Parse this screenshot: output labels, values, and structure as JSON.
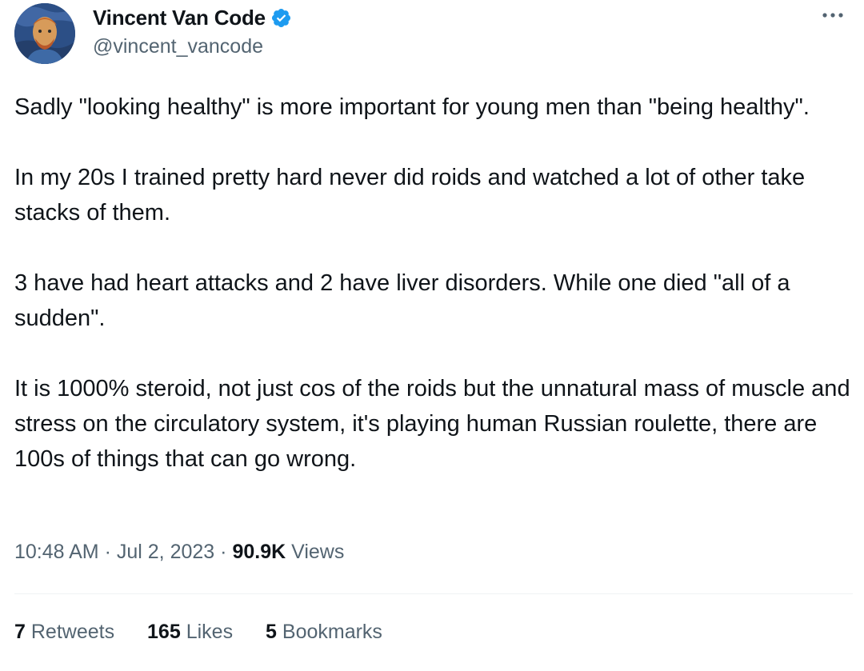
{
  "author": {
    "display_name": "Vincent Van Code",
    "handle": "@vincent_vancode",
    "verified": true,
    "verified_badge_color": "#1d9bf0"
  },
  "tweet": {
    "paragraphs": [
      "Sadly \"looking healthy\" is more important for young men than \"being healthy\".",
      "In my 20s I trained pretty hard never did roids and watched a lot of other take stacks of them.",
      "3 have had heart attacks and 2 have liver disorders.  While one died \"all of a sudden\".",
      "It is 1000% steroid, not just cos of the roids but the unnatural mass of muscle and stress on the circulatory system, it's playing human Russian roulette, there are 100s of things that can go wrong."
    ],
    "time": "10:48 AM",
    "separator": "·",
    "date": "Jul 2, 2023",
    "views_count": "90.9K",
    "views_label": "Views"
  },
  "stats": {
    "retweets_count": "7",
    "retweets_label": "Retweets",
    "likes_count": "165",
    "likes_label": "Likes",
    "bookmarks_count": "5",
    "bookmarks_label": "Bookmarks"
  },
  "icons": {
    "more": "more-options-icon",
    "verified": "verified-badge-icon"
  },
  "colors": {
    "text_primary": "#0f1419",
    "text_secondary": "#536471",
    "divider": "#eff3f4"
  }
}
